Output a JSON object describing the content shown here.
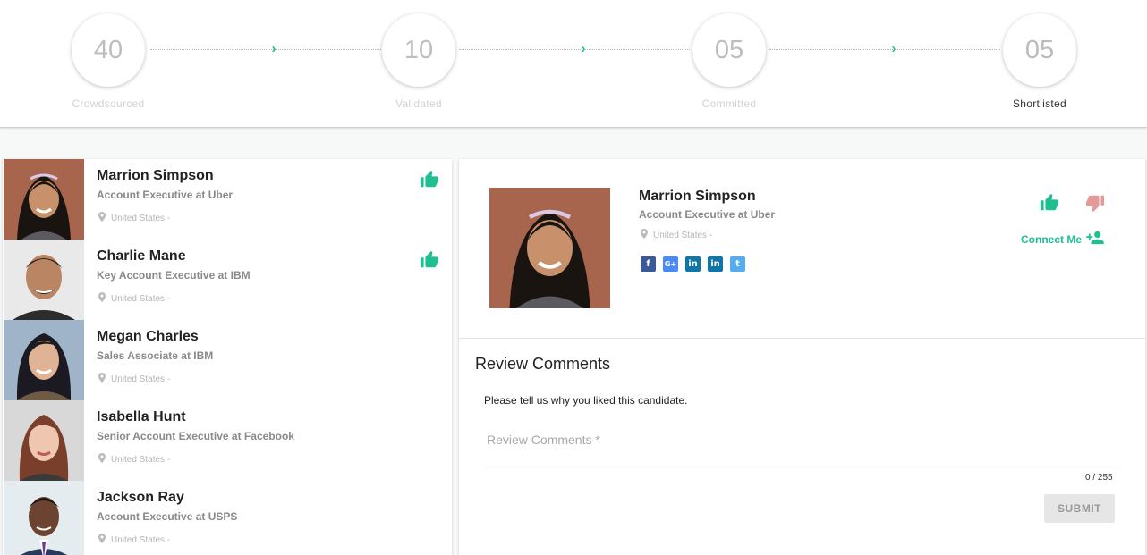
{
  "stepper": {
    "steps": [
      {
        "count": "40",
        "label": "Crowdsourced"
      },
      {
        "count": "10",
        "label": "Validated"
      },
      {
        "count": "05",
        "label": "Committed"
      },
      {
        "count": "05",
        "label": "Shortlisted"
      }
    ],
    "active_step": "Shortlisted",
    "arrow_icon": "chevron-right-icon"
  },
  "candidates": [
    {
      "name": "Marrion Simpson",
      "title": "Account Executive at Uber",
      "location": "United States -",
      "liked": true
    },
    {
      "name": "Charlie Mane",
      "title": "Key Account Executive at IBM",
      "location": "United States -",
      "liked": true
    },
    {
      "name": "Megan Charles",
      "title": "Sales Associate at IBM",
      "location": "United States -",
      "liked": false
    },
    {
      "name": "Isabella Hunt",
      "title": "Senior Account Executive at Facebook",
      "location": "United States -",
      "liked": false
    },
    {
      "name": "Jackson Ray",
      "title": "Account Executive at USPS",
      "location": "United States -",
      "liked": false
    }
  ],
  "detail": {
    "name": "Marrion Simpson",
    "title": "Account Executive at Uber",
    "location": "United States -",
    "socials": [
      {
        "icon": "facebook-icon",
        "glyph": "f",
        "color": "#3b5998"
      },
      {
        "icon": "google-plus-icon",
        "glyph": "G+",
        "color": "#4a8af4"
      },
      {
        "icon": "linkedin-icon",
        "glyph": "in",
        "color": "#0e76a8"
      },
      {
        "icon": "linkedin-icon",
        "glyph": "in",
        "color": "#0e76a8"
      },
      {
        "icon": "twitter-icon",
        "glyph": "t",
        "color": "#55acee"
      }
    ],
    "connect_label": "Connect Me"
  },
  "review": {
    "heading": "Review Comments",
    "prompt": "Please tell us why you liked this candidate.",
    "placeholder": "Review Comments *",
    "counter": "0 / 255",
    "submit_label": "SUBMIT"
  },
  "colors": {
    "accent": "#1fbf92",
    "dislike": "#e59a9a",
    "muted": "#8a8a8a"
  }
}
